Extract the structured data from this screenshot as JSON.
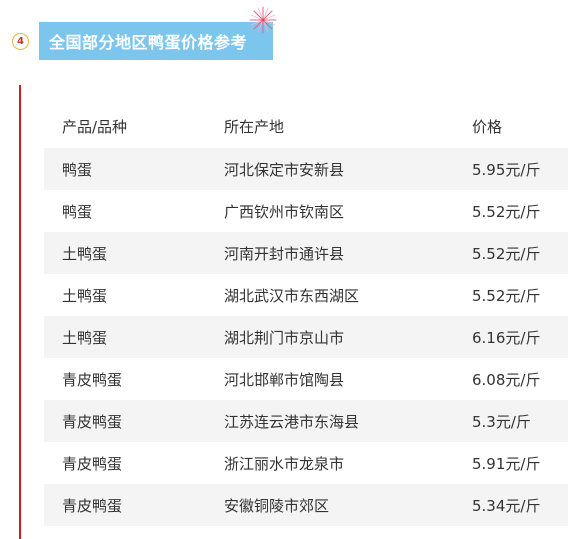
{
  "section": {
    "number": "4",
    "title": "全国部分地区鸭蛋价格参考",
    "accent_color": "#7cc6ee",
    "line_color": "#c9211e"
  },
  "decoration": {
    "icon": "firework-icon"
  },
  "table": {
    "headers": [
      "产品/品种",
      "所在产地",
      "价格"
    ],
    "rows": [
      [
        "鸭蛋",
        "河北保定市安新县",
        "5.95元/斤"
      ],
      [
        "鸭蛋",
        "广西钦州市钦南区",
        "5.52元/斤"
      ],
      [
        "土鸭蛋",
        "河南开封市通许县",
        "5.52元/斤"
      ],
      [
        "土鸭蛋",
        "湖北武汉市东西湖区",
        "5.52元/斤"
      ],
      [
        "土鸭蛋",
        "湖北荆门市京山市",
        "6.16元/斤"
      ],
      [
        "青皮鸭蛋",
        "河北邯郸市馆陶县",
        "6.08元/斤"
      ],
      [
        "青皮鸭蛋",
        "江苏连云港市东海县",
        "5.3元/斤"
      ],
      [
        "青皮鸭蛋",
        "浙江丽水市龙泉市",
        "5.91元/斤"
      ],
      [
        "青皮鸭蛋",
        "安徽铜陵市郊区",
        "5.34元/斤"
      ]
    ]
  }
}
